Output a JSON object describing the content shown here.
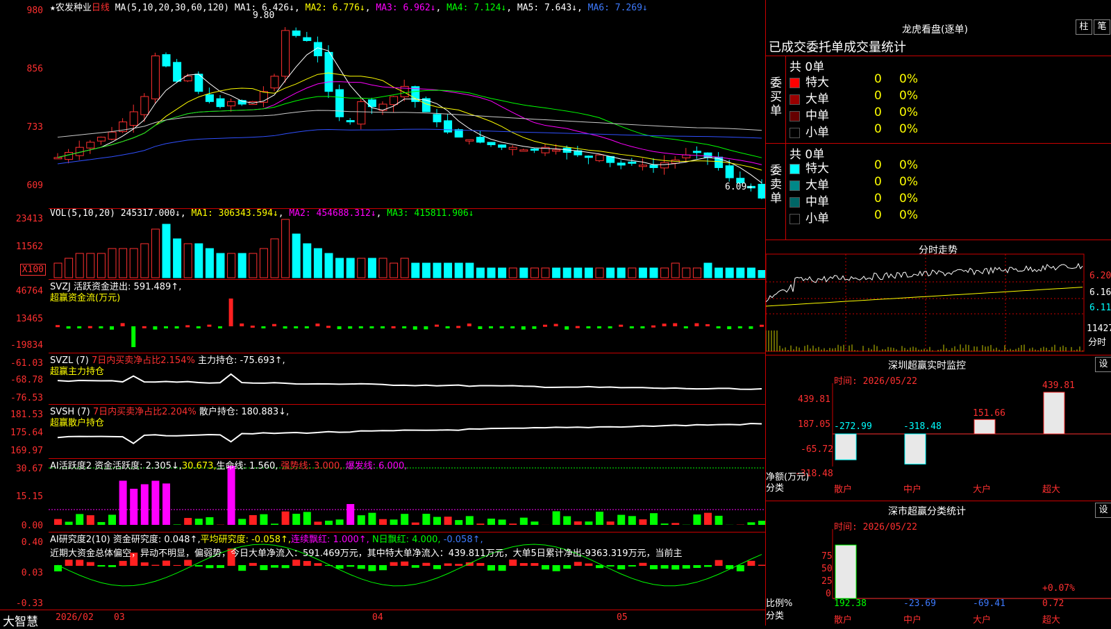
{
  "stock": {
    "star": "★",
    "name": "农发种业",
    "period": "日线",
    "ma_label": "MA(5,10,20,30,60,120)",
    "ma1": "MA1: 6.426↓",
    "ma2": "MA2: 6.776↓",
    "ma3": "MA3: 6.962↓",
    "ma4": "MA4: 7.124↓",
    "ma5": "MA5: 7.643↓",
    "ma6": "MA6: 7.269↓",
    "high_mark": "9.80",
    "low_mark": "6.09→"
  },
  "price_axis": [
    "980",
    "856",
    "733",
    "609"
  ],
  "vol": {
    "label": "VOL(5,10,20)",
    "value": "245317.000↓",
    "ma1": "MA1: 306343.594↓",
    "ma2": "MA2: 454688.312↓",
    "ma3": "MA3: 415811.906↓",
    "axis": [
      "23413",
      "11562",
      "X100"
    ]
  },
  "svzj": {
    "title": "SVZJ",
    "text": "活跃资金进出: 591.489↑,",
    "sub": "超赢资金流(万元)",
    "axis": [
      "46764",
      "13465",
      "-19834"
    ]
  },
  "svzl": {
    "title": "SVZL (7)",
    "text": "7日内买卖净占比2.154%",
    "hold": "主力持仓: -75.693↑,",
    "sub": "超赢主力持仓",
    "axis": [
      "-61.03",
      "-68.78",
      "-76.53"
    ]
  },
  "svsh": {
    "title": "SVSH (7)",
    "text": "7日内买卖净占比2.204%",
    "hold": "散户持仓: 180.883↓,",
    "sub": "超赢散户持仓",
    "axis": [
      "181.53",
      "175.64",
      "169.97"
    ]
  },
  "ai1": {
    "title": "AI活跃度2",
    "fund": "资金活跃度: 2.305↓,",
    "val2": "30.673,",
    "life": "生命线: 1.560,",
    "strong": "强势线: 3.000,",
    "burst": "爆发线: 6.000,",
    "axis": [
      "30.67",
      "15.15",
      "0.00"
    ]
  },
  "ai2": {
    "title": "AI研究度2(10)",
    "fund": "资金研究度: 0.048↑,",
    "avg": "平均研究度: -0.058↑,",
    "red": "连续飘红: 1.000↑,",
    "nred": "N日飘红: 4.000,",
    "last": "-0.058↑,",
    "comment": "近期大资金总体偏空，异动不明显，偏弱势，今日大单净流入：591.469万元，其中特大单净流入：439.811万元，大单5日累计净出-9363.319万元，当前主",
    "axis": [
      "0.40",
      "0.03",
      "-0.33"
    ]
  },
  "bottom": {
    "brand": "大智慧",
    "dates": [
      "2026/02",
      "03",
      "04",
      "05"
    ]
  },
  "right": {
    "lhb_title": "龙虎看盘(逐单)",
    "btn_zhu": "柱",
    "btn_bi": "笔",
    "stats_title": "已成交委托单成交量统计",
    "buy": {
      "side": "委买单",
      "total": "共 0单",
      "rows": [
        {
          "label": "特大",
          "color": "#ff0000",
          "n": "0",
          "p": "0%"
        },
        {
          "label": "大单",
          "color": "#990000",
          "n": "0",
          "p": "0%"
        },
        {
          "label": "中单",
          "color": "#660000",
          "n": "0",
          "p": "0%"
        },
        {
          "label": "小单",
          "color": "#000000",
          "n": "0",
          "p": "0%"
        }
      ]
    },
    "sell": {
      "side": "委卖单",
      "total": "共 0单",
      "rows": [
        {
          "label": "特大",
          "color": "#00ffff",
          "n": "0",
          "p": "0%"
        },
        {
          "label": "大单",
          "color": "#008888",
          "n": "0",
          "p": "0%"
        },
        {
          "label": "中单",
          "color": "#006666",
          "n": "0",
          "p": "0%"
        },
        {
          "label": "小单",
          "color": "#000000",
          "n": "0",
          "p": "0%"
        }
      ]
    },
    "intraday": {
      "title": "分时走势",
      "axis": [
        "6.20",
        "6.16",
        "6.11"
      ],
      "vol": "11427",
      "vol_unit": "分时"
    },
    "sz_monitor": {
      "title": "深圳超赢实时监控",
      "btn": "设",
      "time": "时间: 2026/05/22",
      "axis": [
        "439.81",
        "187.05",
        "-65.72",
        "-318.48"
      ],
      "ylabel": "净额(万元)",
      "xlabel": "分类",
      "bars": [
        {
          "cat": "散户",
          "value": "-272.99"
        },
        {
          "cat": "中户",
          "value": "-318.48"
        },
        {
          "cat": "大户",
          "value": "151.66"
        },
        {
          "cat": "超大",
          "value": "439.81"
        }
      ]
    },
    "sz_class": {
      "title": "深市超赢分类统计",
      "btn": "设",
      "time": "时间: 2026/05/22",
      "axis": [
        "75",
        "50",
        "25",
        "0"
      ],
      "ylabel": "比例%",
      "xlabel": "分类",
      "extra": "+0.07%",
      "bars": [
        {
          "cat": "散户",
          "value": "192.38"
        },
        {
          "cat": "中户",
          "value": "-23.69"
        },
        {
          "cat": "大户",
          "value": "-69.41"
        },
        {
          "cat": "超大",
          "value": "0.72"
        }
      ]
    }
  }
}
